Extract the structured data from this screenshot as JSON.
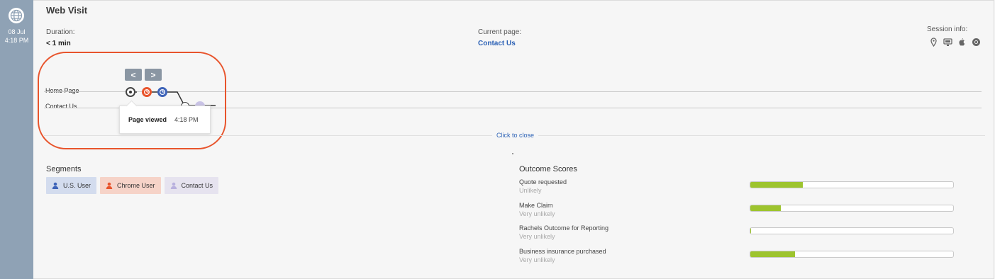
{
  "rail": {
    "date": "08 Jul",
    "time": "4:18 PM",
    "icon": "globe-icon"
  },
  "header": {
    "title": "Web Visit",
    "duration_label": "Duration:",
    "duration_value": "< 1 min",
    "current_page_label": "Current page:",
    "current_page_value": "Contact Us",
    "session_label": "Session info:",
    "session_icons": [
      "location-pin-icon",
      "desktop-icon",
      "apple-icon",
      "chrome-icon"
    ]
  },
  "timeline": {
    "prev_label": "<",
    "next_label": ">",
    "rows": [
      "Home Page",
      "Contact Us"
    ],
    "tooltip": {
      "label": "Page viewed",
      "time": "4:18 PM"
    },
    "close_label": "Click to close"
  },
  "segments": {
    "title": "Segments",
    "items": [
      {
        "label": "U.S. User",
        "bg": "#d3dcee",
        "icon_color": "#3d63b8"
      },
      {
        "label": "Chrome User",
        "bg": "#f6d3c8",
        "icon_color": "#e8542c"
      },
      {
        "label": "Contact Us",
        "bg": "#e6e3ef",
        "icon_color": "#b8b0de"
      }
    ]
  },
  "outcomes": {
    "title": "Outcome Scores",
    "items": [
      {
        "name": "Quote requested",
        "likelihood": "Unlikely",
        "score": 0.26
      },
      {
        "name": "Make Claim",
        "likelihood": "Very unlikely",
        "score": 0.15
      },
      {
        "name": "Rachels Outcome for Reporting",
        "likelihood": "Very unlikely",
        "score": 0.005
      },
      {
        "name": "Business insurance purchased",
        "likelihood": "Very unlikely",
        "score": 0.22
      }
    ]
  },
  "colors": {
    "accent_blue": "#2d62b6",
    "highlight": "#e8542c",
    "score_fill": "#9dc42e",
    "rail": "#8fa2b5"
  }
}
